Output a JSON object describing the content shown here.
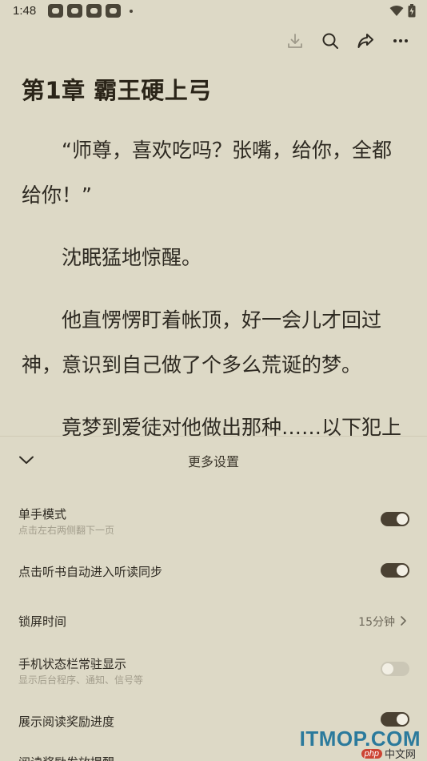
{
  "status_bar": {
    "time": "1:48"
  },
  "toolbar": {
    "icons": [
      "download-icon",
      "search-icon",
      "share-icon",
      "more-icon"
    ]
  },
  "chapter": {
    "title": "第1章 霸王硬上弓"
  },
  "content": {
    "paragraphs": [
      "“师尊，喜欢吃吗？张嘴，给你，全都给你！”",
      "沈眠猛地惊醒。",
      "他直愣愣盯着帐顶，好一会儿才回过神，意识到自己做了个多么荒诞的梦。",
      "竟梦到爱徒对他做出那种……以下犯上"
    ]
  },
  "settings_sheet": {
    "title": "更多设置",
    "items": [
      {
        "label": "单手模式",
        "sublabel": "点击左右两侧翻下一页",
        "toggle": true
      },
      {
        "label": "点击听书自动进入听读同步",
        "toggle": true
      },
      {
        "label": "锁屏时间",
        "value": "15分钟"
      },
      {
        "label": "手机状态栏常驻显示",
        "sublabel": "显示后台程序、通知、信号等",
        "toggle": false
      },
      {
        "label": "展示阅读奖励进度",
        "toggle": true
      },
      {
        "label": "阅读奖励发放提醒"
      }
    ]
  },
  "watermark": {
    "text": "ITMOP.COM",
    "badge": "php",
    "sub": "中文网"
  },
  "colors": {
    "background": "#ddd9c6",
    "toggle_on": "#4a4132",
    "toggle_off": "#cbc7b6",
    "watermark": "#2b7a9c"
  }
}
